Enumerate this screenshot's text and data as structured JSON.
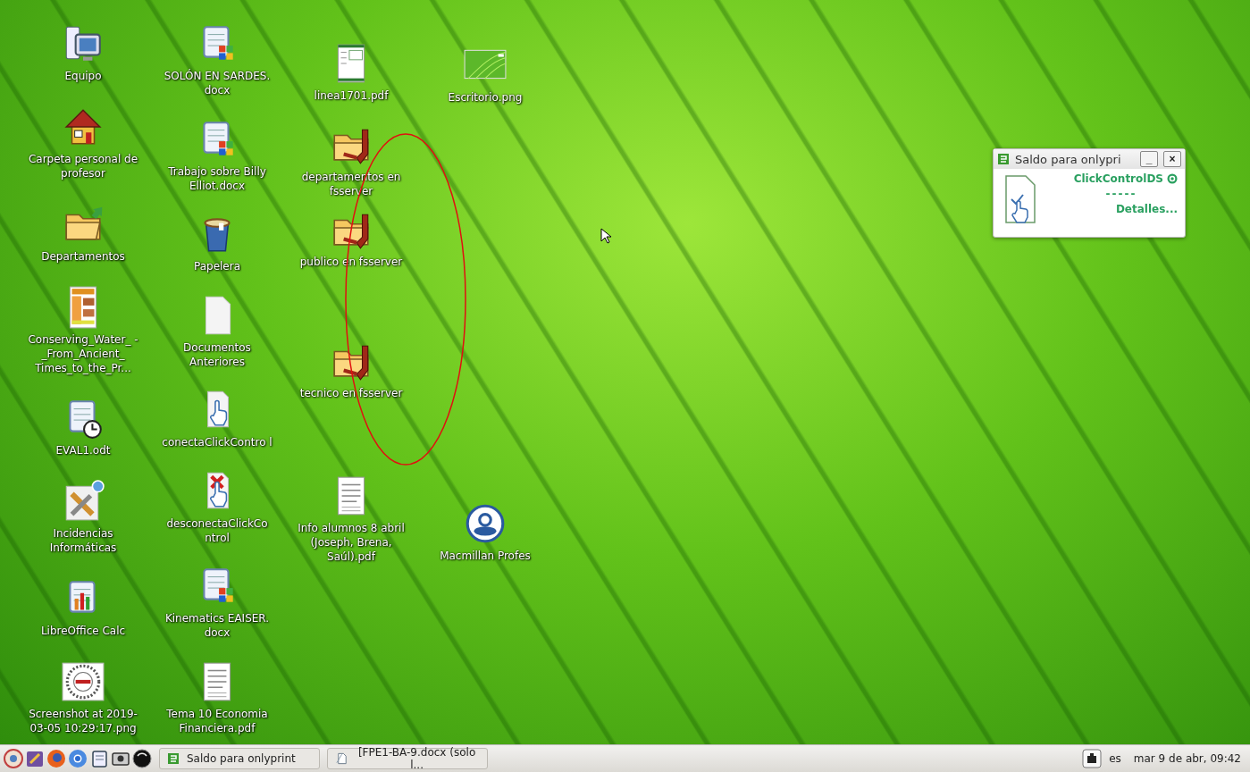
{
  "desktop": {
    "columns": [
      {
        "icons": [
          {
            "kind": "computer",
            "label": "Equipo"
          },
          {
            "kind": "home",
            "label": "Carpeta personal de profesor"
          },
          {
            "kind": "folder-link",
            "label": "Departamentos"
          },
          {
            "kind": "poster",
            "label": "Conserving_Water_ -_From_Ancient_ Times_to_the_Pr..."
          },
          {
            "kind": "doc-clock",
            "label": "EVAL1.odt"
          },
          {
            "kind": "tools",
            "label": "Incidencias Informáticas"
          },
          {
            "kind": "calc",
            "label": "LibreOffice Calc"
          },
          {
            "kind": "image-circle",
            "label": "Screenshot at 2019- 03-05 10:29:17.png"
          }
        ]
      },
      {
        "icons": [
          {
            "kind": "word",
            "label": "SOLÓN EN SARDES. docx"
          },
          {
            "kind": "word",
            "label": "Trabajo sobre Billy Elliot.docx"
          },
          {
            "kind": "trash",
            "label": "Papelera"
          },
          {
            "kind": "blank",
            "label": "Documentos Anteriores"
          },
          {
            "kind": "click",
            "label": "conectaClickContro l"
          },
          {
            "kind": "click-x",
            "label": "desconectaClickCo ntrol"
          },
          {
            "kind": "word",
            "label": "Kinematics EAISER. docx"
          },
          {
            "kind": "pdf",
            "label": "Tema 10 Economia Financiera.pdf"
          }
        ]
      },
      {
        "icons": [
          {
            "kind": "form",
            "label": "linea1701.pdf"
          },
          {
            "kind": "net-folder",
            "label": "departamentos en fsserver"
          },
          {
            "kind": "net-folder",
            "label": "publico en fsserver"
          },
          {
            "kind": "net-folder",
            "label": "tecnico en fsserver"
          },
          {
            "kind": "pdf",
            "label": "Info alumnos 8 abril (Joseph, Brena, Saúl).pdf"
          }
        ]
      },
      {
        "icons": [
          {
            "kind": "wallpaper",
            "label": "Escritorio.png"
          },
          {
            "kind": "dvd",
            "label": "Macmillan Profes"
          }
        ]
      }
    ]
  },
  "widget": {
    "title": "Saldo para onlypri",
    "minimize": "_",
    "close": "×",
    "service": "ClickControlDS",
    "balance": "-----",
    "details_link": "Detalles..."
  },
  "taskbar": {
    "launchers": [
      {
        "kind": "help"
      },
      {
        "kind": "edit"
      },
      {
        "kind": "firefox"
      },
      {
        "kind": "chromium"
      },
      {
        "kind": "notes"
      },
      {
        "kind": "screenshot"
      },
      {
        "kind": "terminal"
      }
    ],
    "tasks": [
      {
        "kind": "widget",
        "label": "Saldo para onlyprint"
      },
      {
        "kind": "document",
        "label": "[FPE1-BA-9.docx (solo l..."
      }
    ],
    "keyboard_layout": "es",
    "clock": "mar  9 de abr, 09:42"
  }
}
